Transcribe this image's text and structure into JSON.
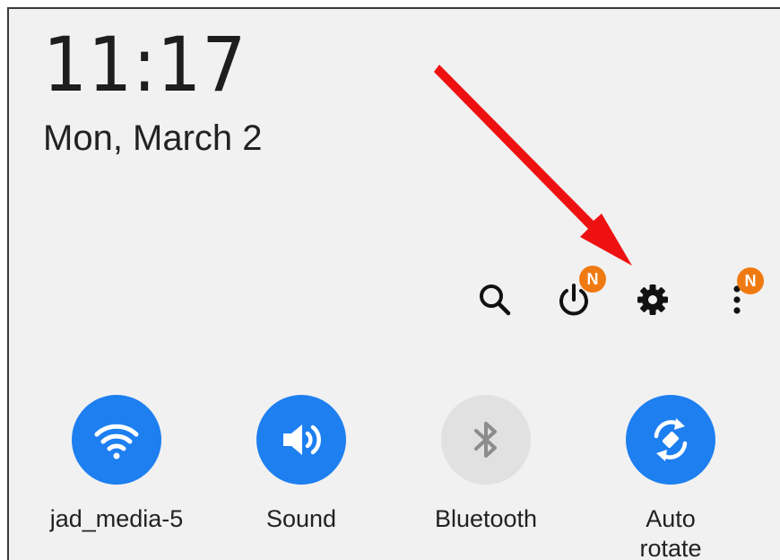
{
  "status": {
    "time": "11:17",
    "date": "Mon, March 2"
  },
  "toolbar": {
    "power_badge": "N",
    "more_badge": "N",
    "icons": [
      "search-icon",
      "power-icon",
      "gear-icon",
      "more-vertical-icon"
    ]
  },
  "quick_settings": [
    {
      "label": "jad_media-5",
      "icon": "wifi-icon",
      "active": true
    },
    {
      "label": "Sound",
      "icon": "speaker-icon",
      "active": true
    },
    {
      "label": "Bluetooth",
      "icon": "bluetooth-icon",
      "active": false
    },
    {
      "label_line1": "Auto",
      "label_line2": "rotate",
      "icon": "auto-rotate-icon",
      "active": true
    }
  ],
  "colors": {
    "panel_bg": "#f1f1f1",
    "active_tile": "#1d7ff0",
    "inactive_tile": "#e1e1e1",
    "badge": "#f07a12",
    "annotation_arrow": "#ee1111"
  }
}
